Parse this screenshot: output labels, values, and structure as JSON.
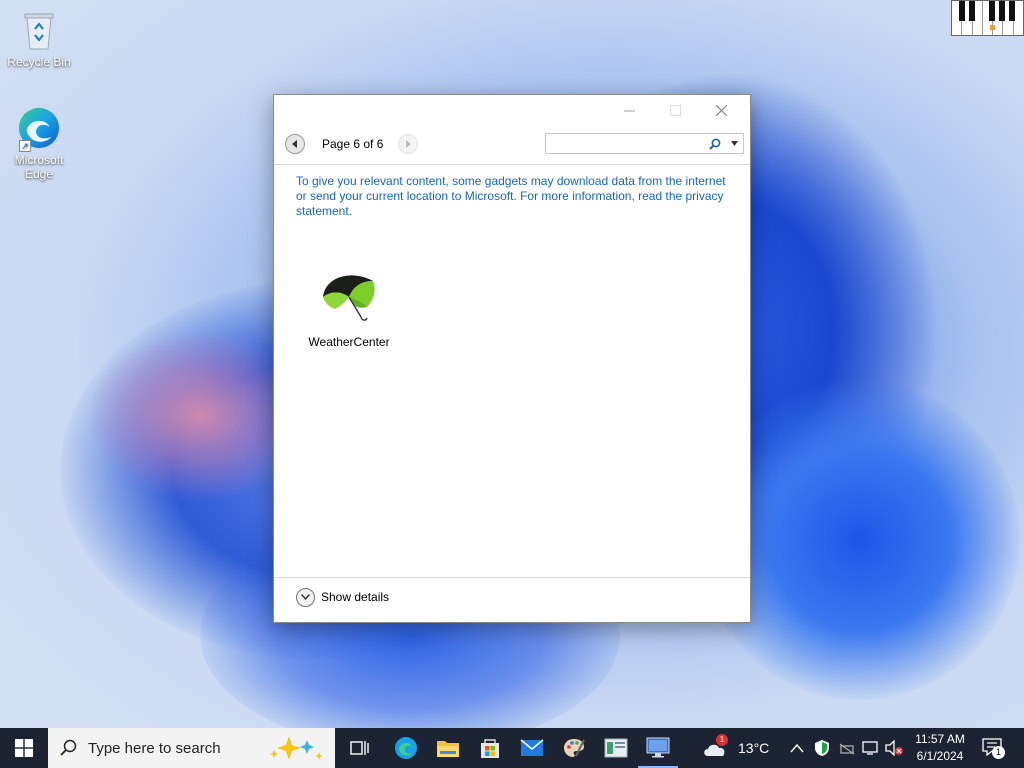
{
  "desktop": {
    "icons": [
      {
        "label": "Recycle Bin"
      },
      {
        "label": "Microsoft Edge"
      }
    ]
  },
  "window": {
    "nav": {
      "page_label": "Page 6 of 6"
    },
    "search": {
      "placeholder": ""
    },
    "info_text": "To give you relevant content, some gadgets may download data from the internet or send your current location to Microsoft. For more information, read the privacy statement.",
    "gadgets": [
      {
        "label": "WeatherCenter"
      }
    ],
    "show_details_label": "Show details"
  },
  "taskbar": {
    "search_placeholder": "Type here to search",
    "weather": {
      "temp": "13°C",
      "badge": "1"
    },
    "clock": {
      "time": "11:57 AM",
      "date": "6/1/2024"
    },
    "notification_count": "1"
  },
  "colors": {
    "taskbar": "#1c2433",
    "link_blue": "#1565c0"
  }
}
